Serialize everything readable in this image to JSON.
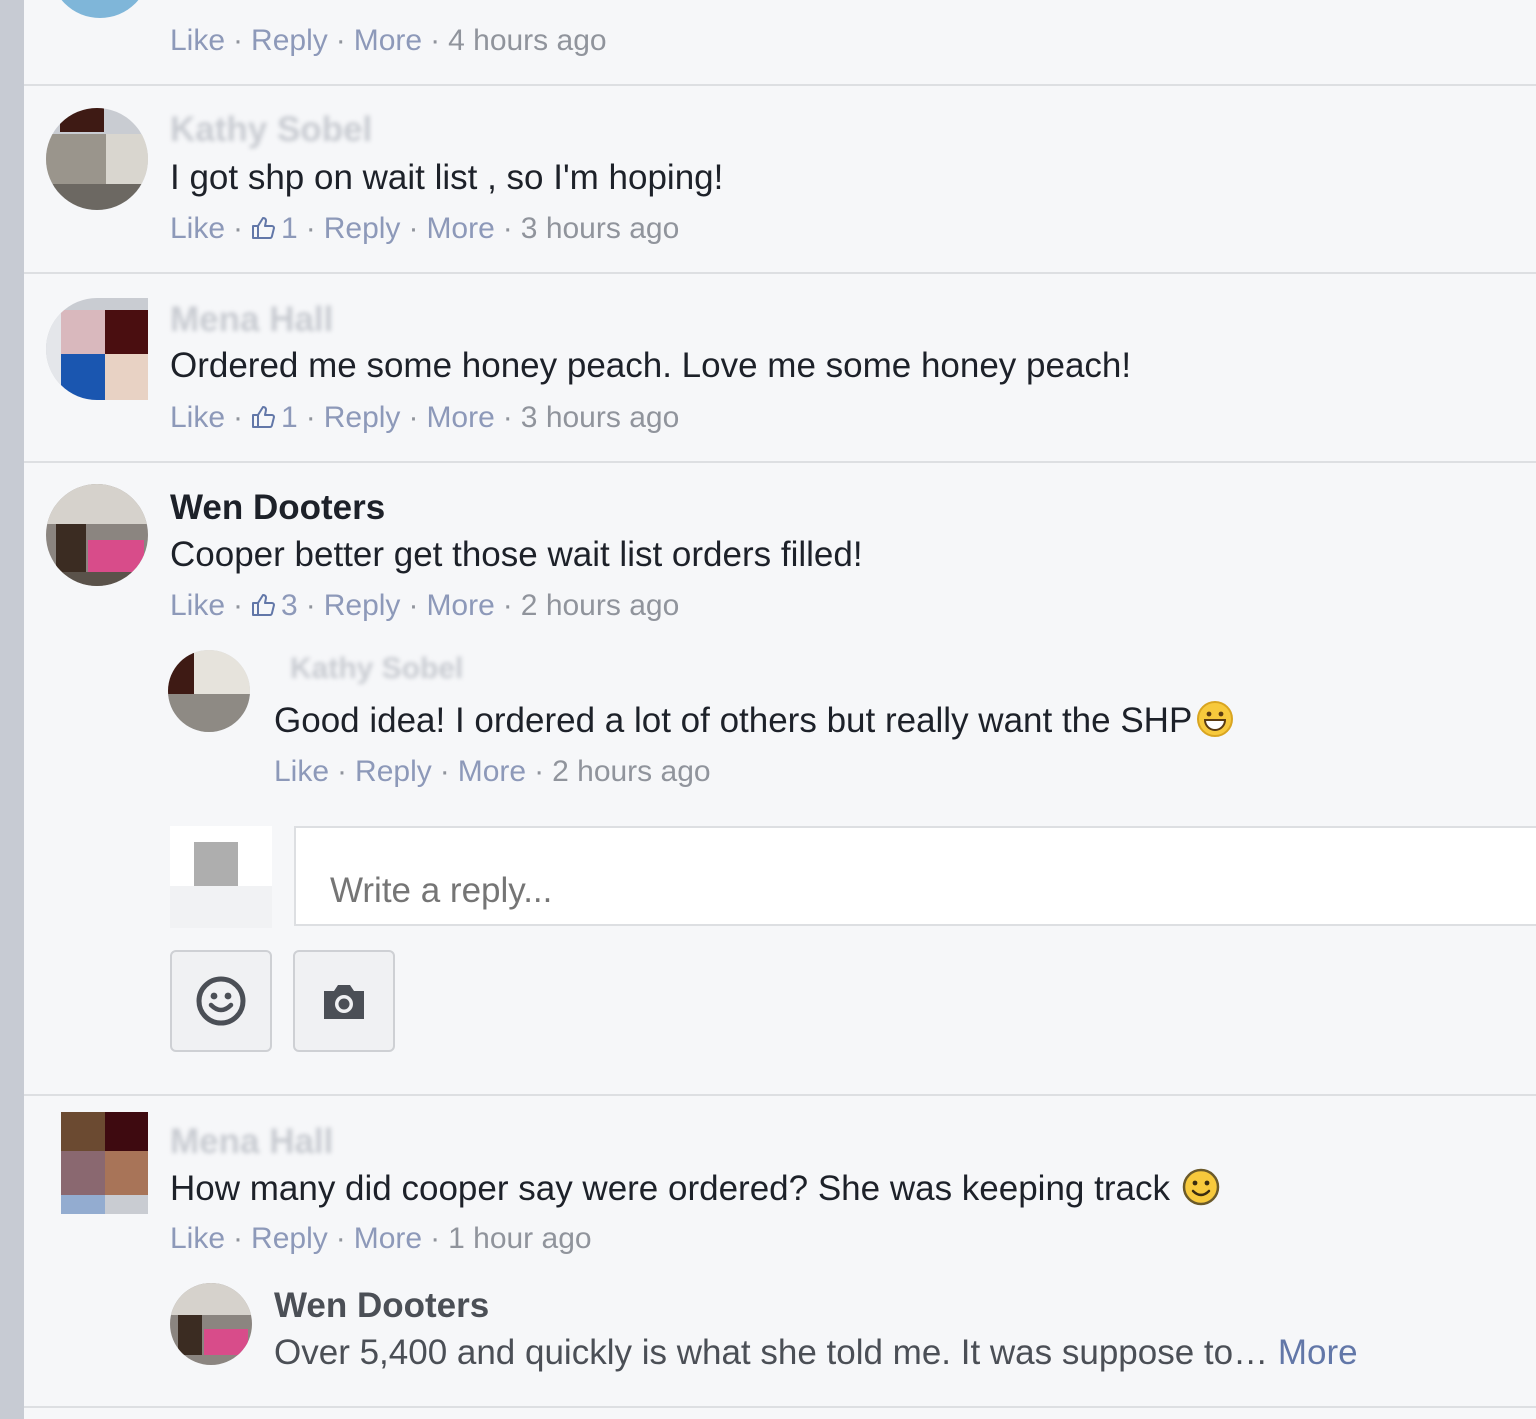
{
  "comments": [
    {
      "author": "",
      "text": "",
      "meta": {
        "like": "Like",
        "reply": "Reply",
        "more": "More",
        "time": "4 hours ago",
        "likes": ""
      }
    },
    {
      "author": "Kathy Sobel",
      "text": "I got shp on wait list , so I'm hoping!",
      "meta": {
        "like": "Like",
        "likes": "1",
        "reply": "Reply",
        "more": "More",
        "time": "3 hours ago"
      }
    },
    {
      "author": "Mena Hall",
      "text": "Ordered me some honey peach. Love me some honey peach!",
      "meta": {
        "like": "Like",
        "likes": "1",
        "reply": "Reply",
        "more": "More",
        "time": "3 hours ago"
      }
    },
    {
      "author": "Wen Dooters",
      "text": "Cooper better get those wait list orders filled!",
      "meta": {
        "like": "Like",
        "likes": "3",
        "reply": "Reply",
        "more": "More",
        "time": "2 hours ago"
      }
    },
    {
      "author": "Kathy Sobel",
      "text": "Good idea! I ordered a lot of others but really want the SHP",
      "meta": {
        "like": "Like",
        "reply": "Reply",
        "more": "More",
        "time": "2 hours ago"
      }
    },
    {
      "author": "Mena Hall",
      "text": "How many did cooper say were ordered? She was keeping track",
      "meta": {
        "like": "Like",
        "reply": "Reply",
        "more": "More",
        "time": "1 hour ago"
      }
    },
    {
      "author": "Wen Dooters",
      "text": "Over 5,400 and quickly is what she told me. It was suppose to…",
      "more": "More"
    }
  ],
  "reply_box": {
    "placeholder": "Write a reply..."
  },
  "icons": {
    "like": "thumbs-up-icon",
    "emoji": "smiley-icon",
    "camera": "camera-icon"
  }
}
